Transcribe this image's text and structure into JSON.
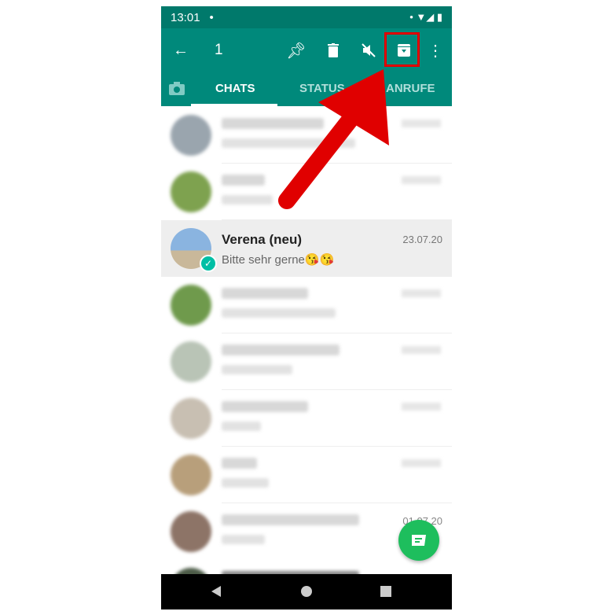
{
  "status_bar": {
    "time": "13:01"
  },
  "toolbar": {
    "selected_count": "1",
    "icons": [
      "back-arrow",
      "pin",
      "delete",
      "mute",
      "archive",
      "more-vertical"
    ]
  },
  "tabs": [
    {
      "label": "CHATS",
      "active": true
    },
    {
      "label": "STATUS"
    },
    {
      "label": "ANRUFE"
    }
  ],
  "selected_chat": {
    "name": "Verena (neu)",
    "date": "23.07.20",
    "message": "Bitte sehr gerne😘😘"
  },
  "visible_date": "01.07.20",
  "colors": {
    "header": "#00897b",
    "status": "#00796b",
    "fab": "#1ebe5d",
    "highlight": "#e00000"
  }
}
